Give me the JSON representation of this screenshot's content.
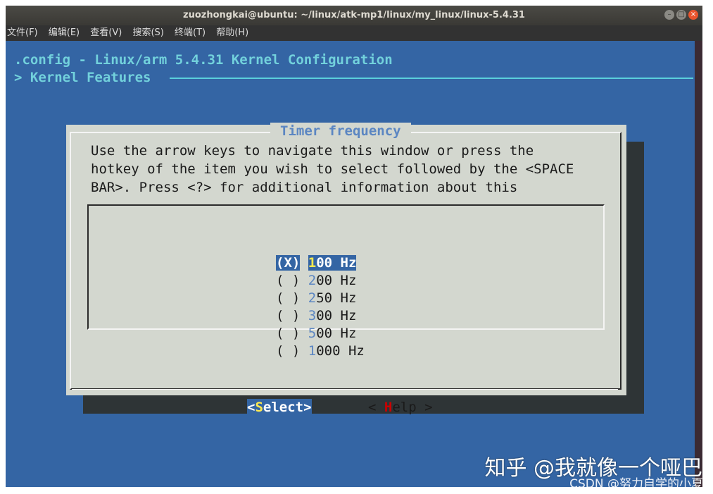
{
  "window": {
    "title": "zuozhongkai@ubuntu: ~/linux/atk-mp1/linux/my_linux/linux-5.4.31",
    "controls": [
      "minimize-icon",
      "maximize-icon",
      "close-icon"
    ]
  },
  "menubar": {
    "items": [
      "文件(F)",
      "编辑(E)",
      "查看(V)",
      "搜索(S)",
      "终端(T)",
      "帮助(H)"
    ]
  },
  "terminal": {
    "config_title": ".config - Linux/arm 5.4.31 Kernel Configuration",
    "breadcrumb": "> Kernel Features"
  },
  "dialog": {
    "title": "Timer frequency",
    "instructions": [
      "Use the arrow keys to navigate this window or press the",
      "hotkey of the item you wish to select followed by the <SPACE",
      "BAR>. Press <?> for additional information about this"
    ],
    "options": [
      {
        "radio": "(X)",
        "hotkey": "1",
        "rest": "00 Hz",
        "selected": true
      },
      {
        "radio": "( )",
        "hotkey": "2",
        "rest": "00 Hz",
        "selected": false
      },
      {
        "radio": "( )",
        "hotkey": "2",
        "rest": "50 Hz",
        "selected": false
      },
      {
        "radio": "( )",
        "hotkey": "3",
        "rest": "00 Hz",
        "selected": false
      },
      {
        "radio": "( )",
        "hotkey": "5",
        "rest": "00 Hz",
        "selected": false
      },
      {
        "radio": "( )",
        "hotkey": "1",
        "rest": "000 Hz",
        "selected": false
      }
    ],
    "buttons": {
      "select": {
        "prefix": "<",
        "hotkey": "S",
        "rest": "elect>"
      },
      "help": {
        "prefix": "< ",
        "hotkey": "H",
        "rest": "elp >"
      }
    }
  },
  "watermark": {
    "line1": "知乎 @我就像一个哑巴",
    "line2": "CSDN @努力自学的小夏"
  },
  "colors": {
    "terminal_bg": "#3465a4",
    "dialog_bg": "#d3d7cf",
    "hotkey_blue": "#5b86c2",
    "hotkey_yellow": "#fce94f",
    "hotkey_red": "#cc0000",
    "title_cyan": "#72d1dc"
  }
}
